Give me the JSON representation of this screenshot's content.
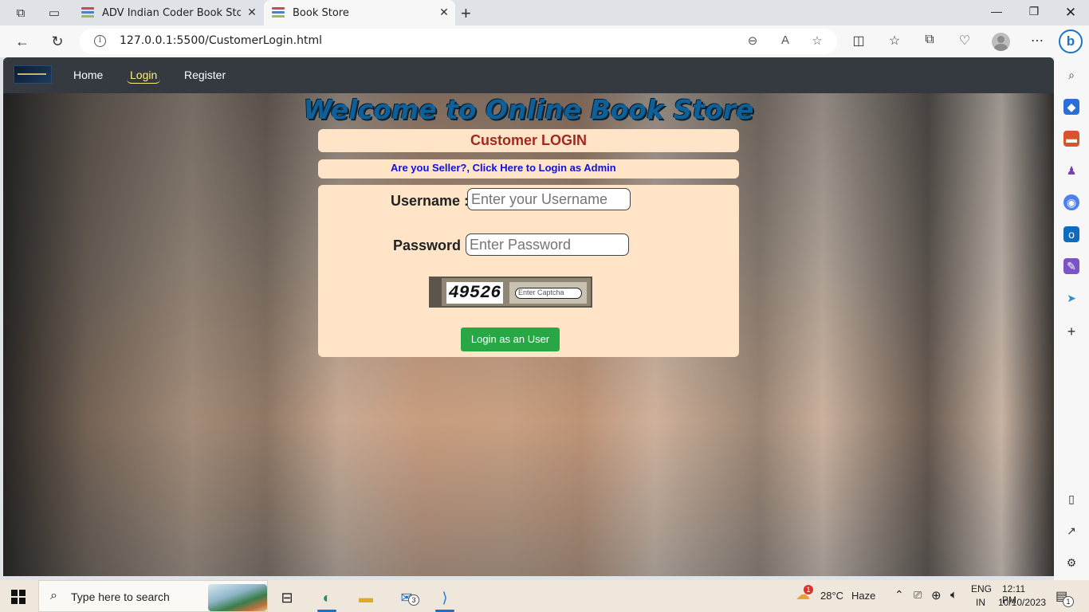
{
  "browser": {
    "tabs": [
      {
        "title": "ADV Indian Coder Book Store",
        "active": false
      },
      {
        "title": "Book Store",
        "active": true
      }
    ],
    "url": "127.0.0.1:5500/CustomerLogin.html"
  },
  "navbar": {
    "links": [
      "Home",
      "Login",
      "Register"
    ],
    "active": "Login"
  },
  "page": {
    "welcome": "Welcome to Online Book Store",
    "customer_login": "Customer LOGIN",
    "seller_link": "Are you Seller?, Click Here to Login as Admin",
    "username_label": "Username :",
    "username_placeholder": "Enter your Username",
    "password_label": "Password :",
    "password_placeholder": "Enter Password",
    "captcha_code": "49526",
    "captcha_placeholder": "Enter Captcha",
    "login_button": "Login as an User"
  },
  "taskbar": {
    "search_placeholder": "Type here to search",
    "mail_badge": "3",
    "weather_temp": "28°C",
    "weather_text": "Haze",
    "weather_badge": "1",
    "language": "ENG",
    "region": "IN",
    "time": "12:11 PM",
    "date": "10/10/2023",
    "notification_count": "1"
  },
  "colors": {
    "navbar_bg": "#343a40",
    "active_link": "#ffef7a",
    "panel_bg": "#ffe4c8",
    "customer_login_text": "#a12a20",
    "seller_link_text": "#1010dd",
    "login_button_bg": "#28a745",
    "welcome_text": "#0f5f99"
  }
}
